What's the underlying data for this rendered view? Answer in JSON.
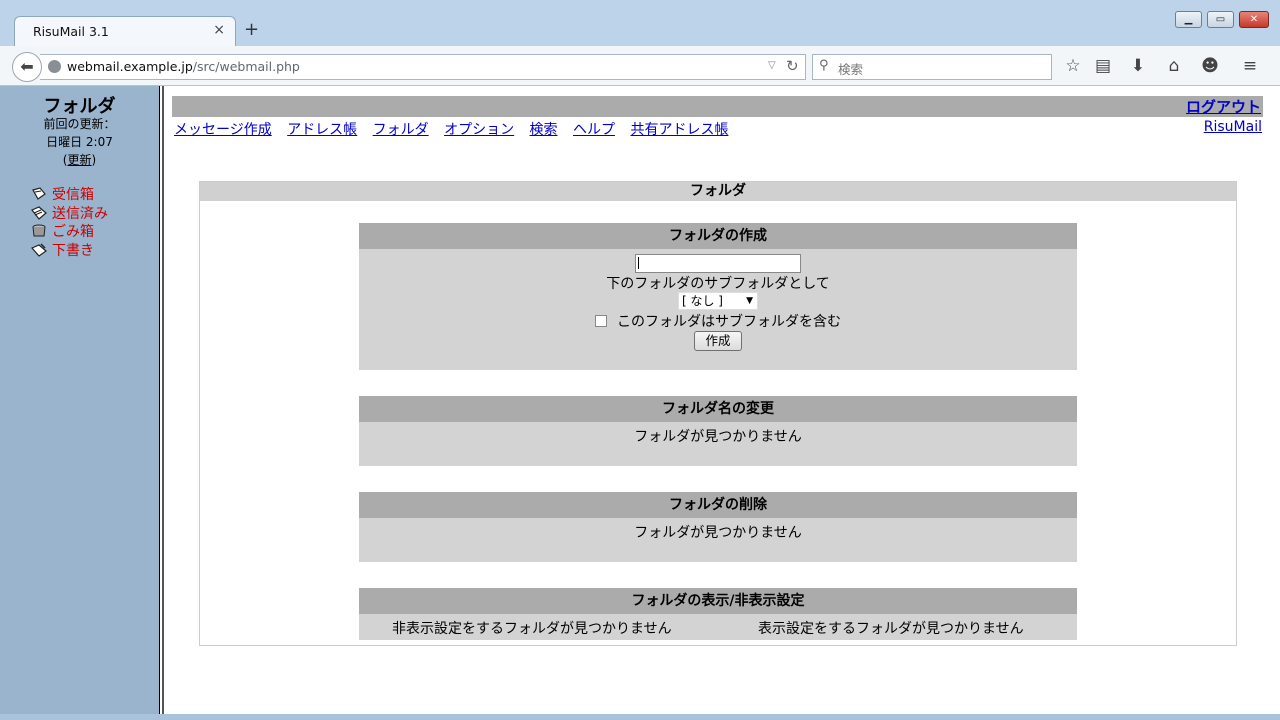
{
  "browser": {
    "tab_title": "RisuMail 3.1",
    "tab_close": "×",
    "new_tab": "+",
    "url_host": "webmail.example.jp",
    "url_path": "/src/webmail.php",
    "search_placeholder": "検索",
    "icons": [
      "back-icon",
      "globe-icon",
      "reload-icon",
      "search-icon",
      "star-icon",
      "library-icon",
      "download-icon",
      "home-icon",
      "chat-icon",
      "menu-icon"
    ]
  },
  "left": {
    "title": "フォルダ",
    "last_update_label": "前回の更新：",
    "update_time": "日曜日 2:07",
    "update_open": "(",
    "update_link": "更新",
    "update_close": ")",
    "folders": [
      {
        "label": "受信箱",
        "icon": "inbox-icon"
      },
      {
        "label": "送信済み",
        "icon": "sent-icon"
      },
      {
        "label": "ごみ箱",
        "icon": "trash-icon"
      },
      {
        "label": "下書き",
        "icon": "drafts-icon"
      }
    ]
  },
  "header": {
    "logout": "ログアウト",
    "menu": [
      "メッセージ作成",
      "アドレス帳",
      "フォルダ",
      "オプション",
      "検索",
      "ヘルプ",
      "共有アドレス帳"
    ],
    "app_name": "RisuMail"
  },
  "main": {
    "title": "フォルダ",
    "create": {
      "heading": "フォルダの作成",
      "input_value": "",
      "subfolder_label": "下のフォルダのサブフォルダとして",
      "parent_option": "[ なし ]",
      "contains_label": "このフォルダはサブフォルダを含む",
      "contains_checked": false,
      "button": "作成"
    },
    "rename": {
      "heading": "フォルダ名の変更",
      "message": "フォルダが見つかりません"
    },
    "delete": {
      "heading": "フォルダの削除",
      "message": "フォルダが見つかりません"
    },
    "toggle": {
      "heading": "フォルダの表示/非表示設定",
      "hidden_message": "非表示設定をするフォルダが見つかりません",
      "visible_message": "表示設定をするフォルダが見つかりません"
    }
  }
}
